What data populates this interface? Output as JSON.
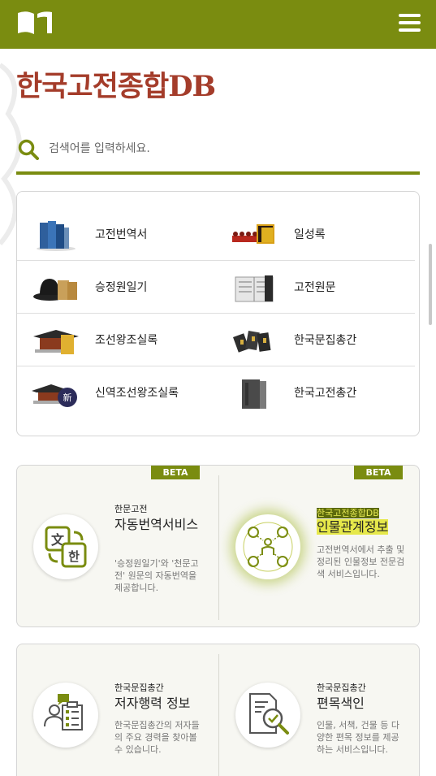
{
  "header": {
    "logo_icon": "book-logo-icon",
    "menu_icon": "hamburger-menu-icon",
    "brand_color": "#7a8c10"
  },
  "site": {
    "title": "한국고전종합DB",
    "title_color": "#a43c2a"
  },
  "search": {
    "placeholder": "검색어를 입력하세요.",
    "value": "",
    "icon": "search-icon"
  },
  "databases": [
    {
      "label": "고전번역서",
      "icon": "books-icon"
    },
    {
      "label": "일성록",
      "icon": "procession-icon"
    },
    {
      "label": "승정원일기",
      "icon": "official-hat-icon"
    },
    {
      "label": "고전원문",
      "icon": "open-book-icon"
    },
    {
      "label": "조선왕조실록",
      "icon": "palace-icon"
    },
    {
      "label": "한국문집총간",
      "icon": "booklets-icon"
    },
    {
      "label": "신역조선왕조실록",
      "icon": "palace-new-icon"
    },
    {
      "label": "한국고전총간",
      "icon": "book-set-icon"
    }
  ],
  "services": [
    {
      "badge": "BETA",
      "kicker": "한문고전",
      "title": "자동번역서비스",
      "desc": "'승정원일기'와 '천문고전' 원문의 자동번역을 제공합니다.",
      "icon": "translate-icon"
    },
    {
      "badge": "BETA",
      "kicker": "한국고전종합DB",
      "title": "인물관계정보",
      "desc": "고전번역서에서 추출 및 정리된 인물정보 전문검색 서비스입니다.",
      "icon": "people-network-icon"
    },
    {
      "kicker": "한국문집총간",
      "title": "저자행력 정보",
      "desc": "한국문집총간의 저자들의 주요 경력을 찾아볼 수 있습니다.",
      "icon": "author-profile-icon"
    },
    {
      "kicker": "한국문집총간",
      "title": "편목색인",
      "desc": "인물, 서책, 건물 등 다양한 편목 정보를 제공하는 서비스입니다.",
      "icon": "document-search-icon"
    }
  ]
}
